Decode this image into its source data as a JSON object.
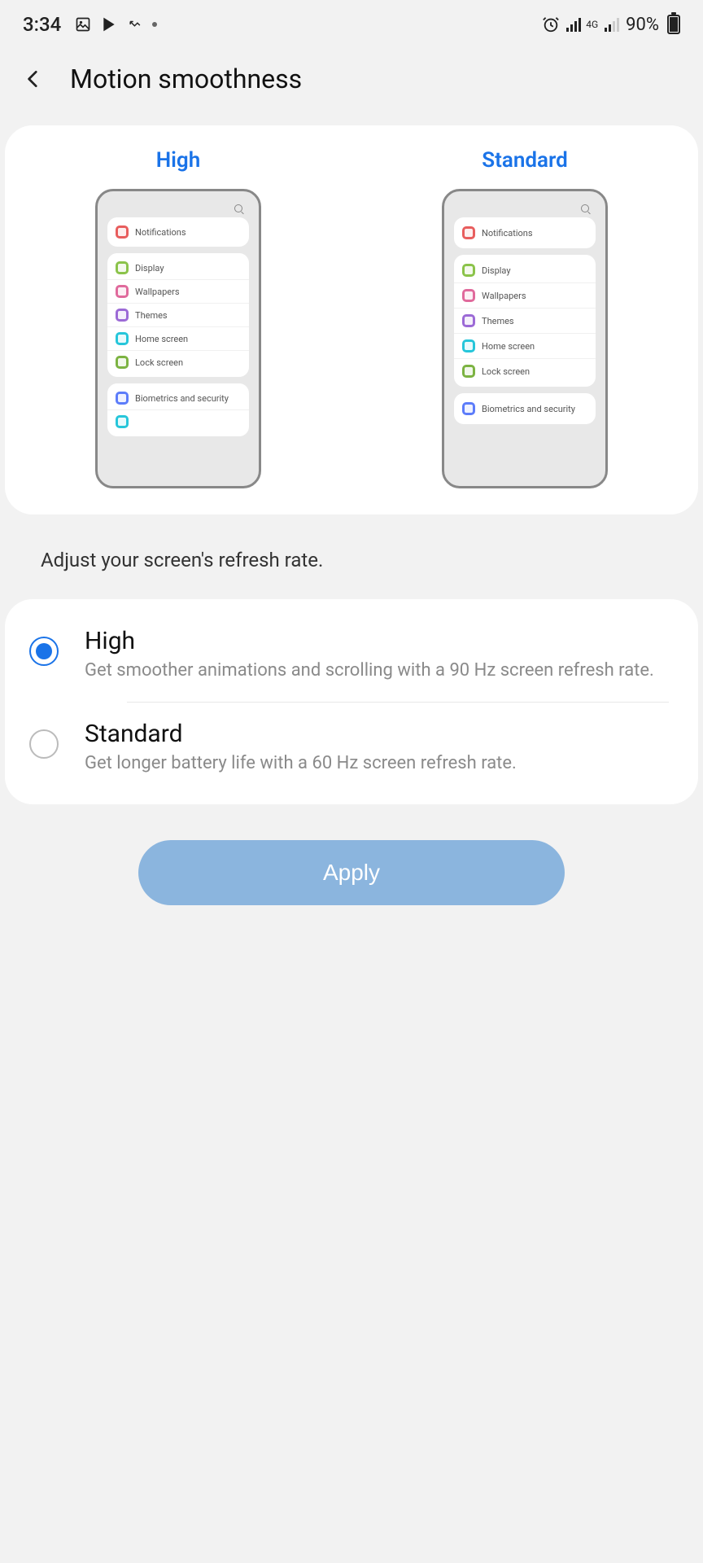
{
  "status": {
    "time": "3:34",
    "network_label": "4G",
    "battery_pct": "90%"
  },
  "header": {
    "title": "Motion smoothness"
  },
  "preview": {
    "high_label": "High",
    "standard_label": "Standard",
    "mock_rows": {
      "notifications": "Notifications",
      "display": "Display",
      "wallpapers": "Wallpapers",
      "themes": "Themes",
      "home": "Home screen",
      "lock": "Lock screen",
      "biometrics": "Biometrics and security"
    }
  },
  "description": "Adjust your screen's refresh rate.",
  "options": {
    "high": {
      "title": "High",
      "subtitle": "Get smoother animations and scrolling with a 90 Hz screen refresh rate.",
      "selected": true
    },
    "standard": {
      "title": "Standard",
      "subtitle": "Get longer battery life with a 60 Hz screen refresh rate.",
      "selected": false
    }
  },
  "apply_label": "Apply"
}
